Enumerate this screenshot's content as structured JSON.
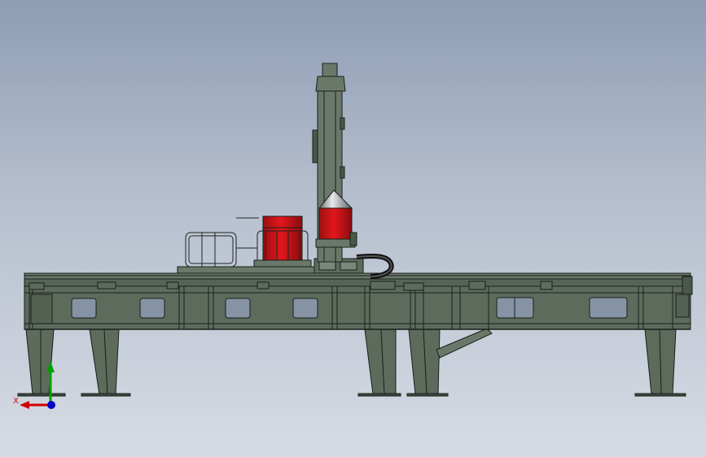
{
  "viewport": {
    "background_top": "#8e9db4",
    "background_bottom": "#d6dbe3"
  },
  "model": {
    "frame_color": "#5d6b5d",
    "frame_edge_color": "#1a1f1a",
    "accent_color": "#d7141a"
  },
  "triad": {
    "x_label": "X",
    "x_color": "#d00000",
    "y_color": "#00a000",
    "z_color": "#0000c8"
  }
}
